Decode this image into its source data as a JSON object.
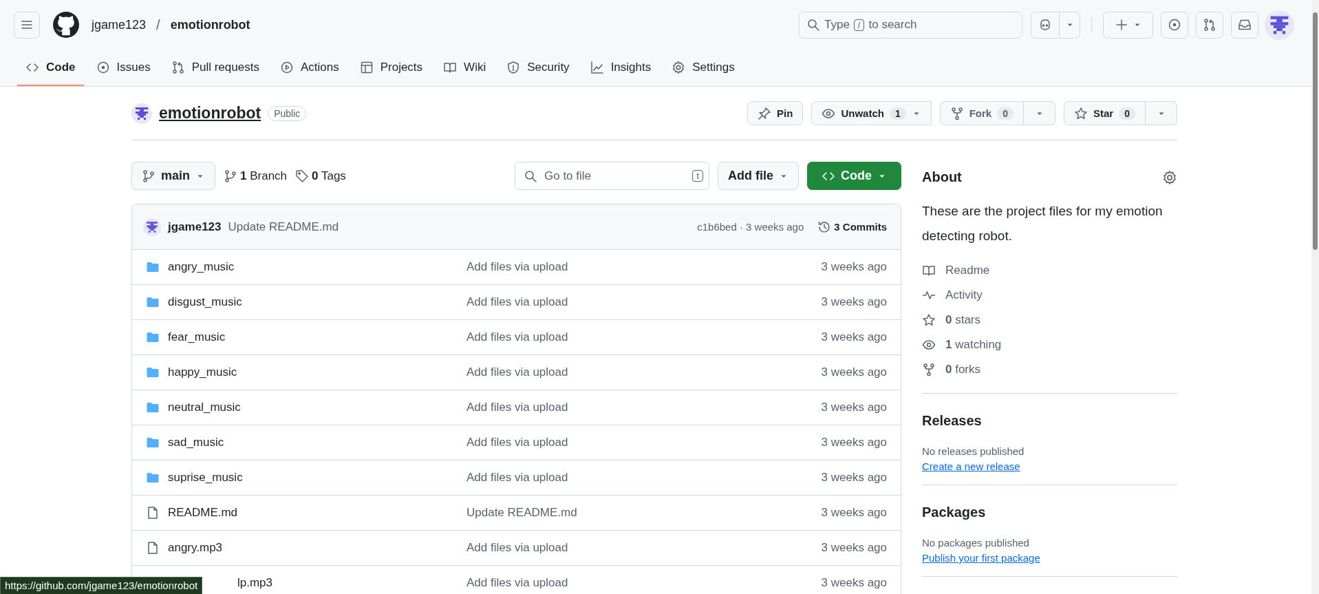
{
  "header": {
    "owner": "jgame123",
    "separator": "/",
    "repo": "emotionrobot",
    "search_placeholder": "Type",
    "search_key": "/",
    "search_suffix": "to search"
  },
  "tabs": [
    {
      "label": "Code",
      "selected": true
    },
    {
      "label": "Issues",
      "selected": false
    },
    {
      "label": "Pull requests",
      "selected": false
    },
    {
      "label": "Actions",
      "selected": false
    },
    {
      "label": "Projects",
      "selected": false
    },
    {
      "label": "Wiki",
      "selected": false
    },
    {
      "label": "Security",
      "selected": false
    },
    {
      "label": "Insights",
      "selected": false
    },
    {
      "label": "Settings",
      "selected": false
    }
  ],
  "repo": {
    "name": "emotionrobot",
    "visibility": "Public",
    "pin": "Pin",
    "unwatch": "Unwatch",
    "watch_count": "1",
    "fork": "Fork",
    "fork_count": "0",
    "star": "Star",
    "star_count": "0"
  },
  "toolbar": {
    "branch": "main",
    "branches_count": "1",
    "branches_label": "Branch",
    "tags_count": "0",
    "tags_label": "Tags",
    "go_to_file": "Go to file",
    "go_key": "t",
    "add_file": "Add file",
    "code": "Code"
  },
  "commit": {
    "author": "jgame123",
    "message": "Update README.md",
    "hash_time": "c1b6bed · 3 weeks ago",
    "commits_count": "3",
    "commits_label": "Commits"
  },
  "files": [
    {
      "kind": "dir",
      "name": "angry_music",
      "message": "Add files via upload",
      "time": "3 weeks ago"
    },
    {
      "kind": "dir",
      "name": "disgust_music",
      "message": "Add files via upload",
      "time": "3 weeks ago"
    },
    {
      "kind": "dir",
      "name": "fear_music",
      "message": "Add files via upload",
      "time": "3 weeks ago"
    },
    {
      "kind": "dir",
      "name": "happy_music",
      "message": "Add files via upload",
      "time": "3 weeks ago"
    },
    {
      "kind": "dir",
      "name": "neutral_music",
      "message": "Add files via upload",
      "time": "3 weeks ago"
    },
    {
      "kind": "dir",
      "name": "sad_music",
      "message": "Add files via upload",
      "time": "3 weeks ago"
    },
    {
      "kind": "dir",
      "name": "suprise_music",
      "message": "Add files via upload",
      "time": "3 weeks ago"
    },
    {
      "kind": "file",
      "name": "README.md",
      "message": "Update README.md",
      "time": "3 weeks ago"
    },
    {
      "kind": "file",
      "name": "angry.mp3",
      "message": "Add files via upload",
      "time": "3 weeks ago"
    },
    {
      "kind": "covered",
      "name": "lp.mp3",
      "message": "Add files via upload",
      "time": "3 weeks ago"
    }
  ],
  "about": {
    "title": "About",
    "description": "These are the project files for my emotion detecting robot.",
    "links": [
      {
        "label": "Readme"
      },
      {
        "label": "Activity"
      },
      {
        "count": "0",
        "label": "stars"
      },
      {
        "count": "1",
        "label": "watching"
      },
      {
        "count": "0",
        "label": "forks"
      }
    ]
  },
  "releases": {
    "title": "Releases",
    "note": "No releases published",
    "link": "Create a new release"
  },
  "packages": {
    "title": "Packages",
    "note": "No packages published",
    "link": "Publish your first package"
  },
  "status_url": "https://github.com/jgame123/emotionrobot"
}
